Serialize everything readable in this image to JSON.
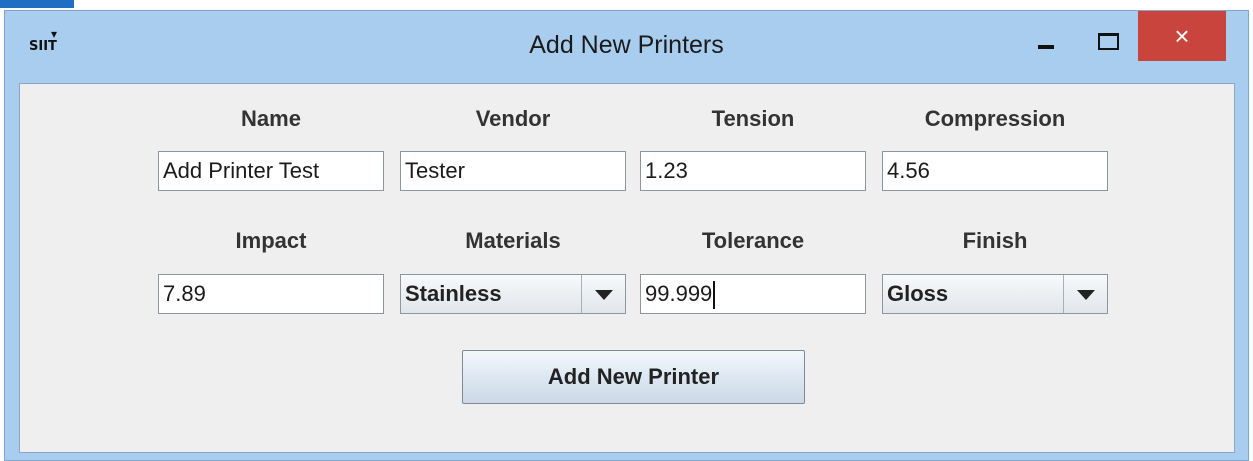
{
  "window": {
    "title": "Add New Printers",
    "app_icon": {
      "icon": "app-logo-icon",
      "text": "SIIT"
    },
    "controls": {
      "minimize": "minimize-icon",
      "maximize": "maximize-icon",
      "close": "×"
    }
  },
  "form": {
    "labels": {
      "name": "Name",
      "vendor": "Vendor",
      "tension": "Tension",
      "compression": "Compression",
      "impact": "Impact",
      "materials": "Materials",
      "tolerance": "Tolerance",
      "finish": "Finish"
    },
    "values": {
      "name": "Add Printer Test",
      "vendor": "Tester",
      "tension": "1.23",
      "compression": "4.56",
      "impact": "7.89",
      "materials": "Stainless",
      "tolerance": "99.999",
      "finish": "Gloss"
    },
    "submit_label": "Add New Printer"
  },
  "colors": {
    "titlebar": "#a9cdee",
    "close_button": "#c8443c",
    "panel": "#efefef"
  }
}
